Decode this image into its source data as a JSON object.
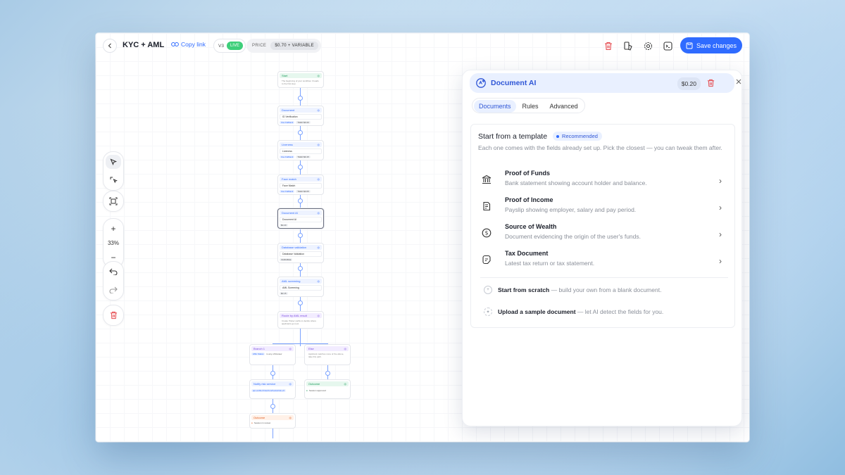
{
  "header": {
    "title": "KYC + AML",
    "copy_link": "Copy link",
    "version": "V3",
    "status": "LIVE",
    "price_label": "PRICE",
    "price_value": "$0.70 + VARIABLE",
    "save_label": "Save changes"
  },
  "toolbar": {
    "zoom": "33%"
  },
  "flow": {
    "start": {
      "title": "Start",
      "desc": "The beginning of your workflow. It leads to the first step."
    },
    "document": {
      "title": "Document",
      "row": "ID Verification",
      "chip": "Use Fallback",
      "chip2": "THEN $0.20"
    },
    "liveness": {
      "title": "Liveness",
      "row": "Liveness",
      "chip": "Use Fallback",
      "chip2": "THEN $0.15"
    },
    "face_match": {
      "title": "Face match",
      "row": "Face Match",
      "chip": "Use Fallback",
      "chip2": "THEN $0.05"
    },
    "document_ai": {
      "title": "Document AI",
      "row": "Document AI",
      "chip": "$0.20"
    },
    "db_validation": {
      "title": "Database validation",
      "row": "Database Validation",
      "chip": "VARIABLE"
    },
    "aml": {
      "title": "AML screening",
      "row": "AML Screening",
      "chip": "$0.15"
    },
    "route": {
      "title": "Route by AML result",
      "desc": "Create 'if/else' paths to decide where applicants go next."
    },
    "branch": {
      "title": "Branch 1",
      "chip": "AML Status",
      "chip2": "is any of Review"
    },
    "else": {
      "title": "Else",
      "desc": "Applicant matches none of the above, take this path."
    },
    "notify": {
      "title": "Notify risk service",
      "row": "api.verifier.fintechco/hooks/risk-v2"
    },
    "outcome1": {
      "title": "Outcome",
      "row": "Session approved"
    },
    "outcome2": {
      "title": "Outcome",
      "row": "Session in review"
    }
  },
  "panel": {
    "title": "Document AI",
    "price": "$0.20",
    "tabs": [
      "Documents",
      "Rules",
      "Advanced"
    ],
    "card_title": "Start from a template",
    "badge": "Recommended",
    "card_sub": "Each one comes with the fields already set up. Pick the closest — you can tweak them after.",
    "templates": [
      {
        "name": "Proof of Funds",
        "desc": "Bank statement showing account holder and balance.",
        "icon": "bank-icon"
      },
      {
        "name": "Proof of Income",
        "desc": "Payslip showing employer, salary and pay period.",
        "icon": "receipt-icon"
      },
      {
        "name": "Source of Wealth",
        "desc": "Document evidencing the origin of the user's funds.",
        "icon": "dollar-icon"
      },
      {
        "name": "Tax Document",
        "desc": "Latest tax return or tax statement.",
        "icon": "tax-doc-icon"
      }
    ],
    "scratch_bold": "Start from scratch",
    "scratch_rest": " — build your own from a blank document.",
    "upload_bold": "Upload a sample document",
    "upload_rest": " — let AI detect the fields for you."
  },
  "colors": {
    "accent": "#2f6bff",
    "live": "#3ecf7a",
    "danger": "#e5484d"
  }
}
